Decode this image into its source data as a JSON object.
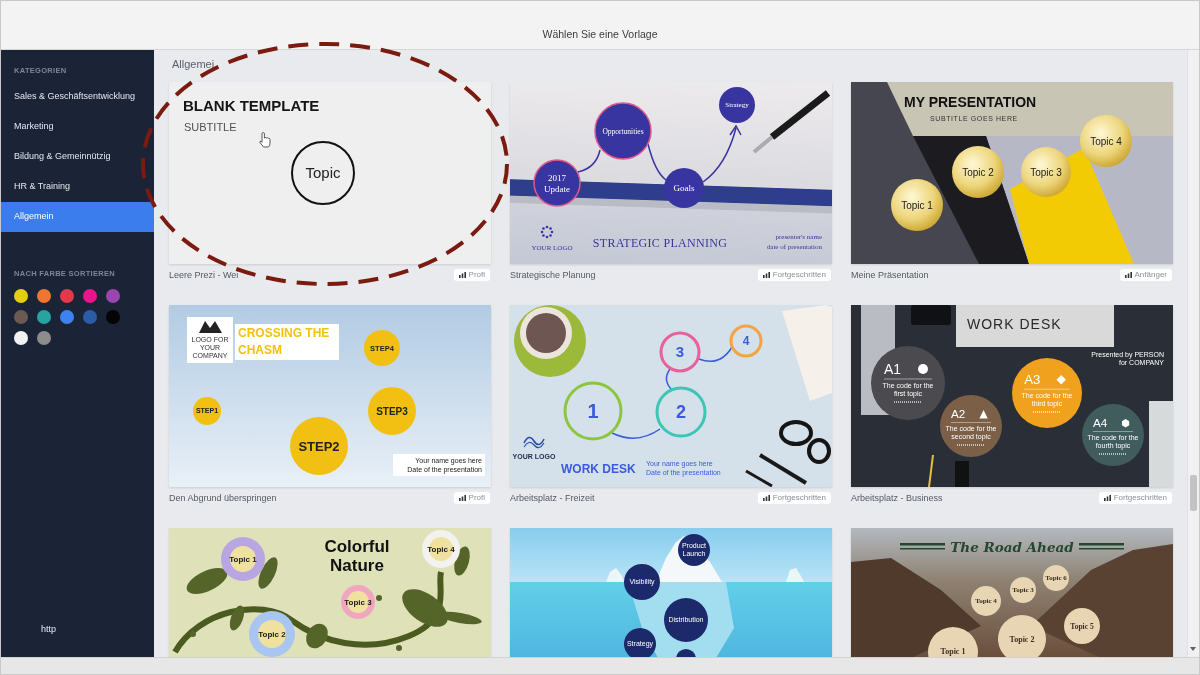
{
  "window": {
    "title": "Wählen Sie eine Vorlage"
  },
  "sidebar": {
    "categories_heading": "KATEGORIEN",
    "categories": [
      {
        "label": "Sales & Geschäftsentwicklung",
        "selected": false
      },
      {
        "label": "Marketing",
        "selected": false
      },
      {
        "label": "Bildung & Gemeinnützig",
        "selected": false
      },
      {
        "label": "HR & Training",
        "selected": false
      },
      {
        "label": "Allgemein",
        "selected": true
      }
    ],
    "color_heading": "NACH FARBE SORTIEREN",
    "colors": [
      {
        "color": "#e3cf10"
      },
      {
        "color": "#ee7432"
      },
      {
        "color": "#e23a4b"
      },
      {
        "color": "#e8168b"
      },
      {
        "color": "#9b45b0"
      },
      {
        "color": "#6c5a52"
      },
      {
        "color": "#28a3a0"
      },
      {
        "color": "#3c83ef"
      },
      {
        "color": "#2b5ca8"
      },
      {
        "color": "#040404"
      },
      {
        "color": "#f2f2f2"
      },
      {
        "color": "#8c8c8c"
      }
    ],
    "footer": "http"
  },
  "content": {
    "heading": "Allgemei",
    "templates": [
      {
        "name": "Leere Prezi - Wei",
        "difficulty": "Profi",
        "slide": {
          "kind": "blank",
          "title": "BLANK TEMPLATE",
          "subtitle": "SUBTITLE",
          "topic": "Topic"
        }
      },
      {
        "name": "Strategische Planung",
        "difficulty": "Fortgeschritten",
        "slide": {
          "kind": "strategy",
          "topics": [
            "Strategy",
            "Opportunities",
            "2017 Update",
            "Goals"
          ],
          "title": "STRATEGIC PLANNING",
          "logo": "YOUR LOGO",
          "presenter": "presenter's name",
          "date": "date of presentation"
        }
      },
      {
        "name": "Meine Präsentation",
        "difficulty": "Anfänger",
        "slide": {
          "kind": "geometric",
          "title": "MY PRESENTATION",
          "subtitle": "SUBTITLE GOES HERE",
          "topics": [
            "Topic 1",
            "Topic 2",
            "Topic 3",
            "Topic 4"
          ]
        }
      },
      {
        "name": "Den Abgrund überspringen",
        "difficulty": "Profi",
        "slide": {
          "kind": "chasm",
          "logo": "LOGO FOR YOUR COMPANY",
          "title": "CROSSING THE CHASM",
          "steps": [
            "STEP4",
            "STEP3",
            "STEP1",
            "STEP2"
          ],
          "name": "Your name goes here",
          "date": "Date of the presentation"
        }
      },
      {
        "name": "Arbeitsplatz - Freizeit",
        "difficulty": "Fortgeschritten",
        "slide": {
          "kind": "desk-leisure",
          "steps": [
            "1",
            "2",
            "3",
            "4"
          ],
          "logo": "YOUR LOGO",
          "title": "WORK DESK",
          "name": "Your name goes here",
          "date": "Date of the presentation"
        }
      },
      {
        "name": "Arbeitsplatz - Business",
        "difficulty": "Fortgeschritten",
        "slide": {
          "kind": "desk-business",
          "title": "WORK DESK",
          "presenter": "Presented by PERSON",
          "company": "for COMPANY",
          "topics": [
            {
              "label": "A1",
              "caption": "The code for the first topic"
            },
            {
              "label": "A2",
              "caption": "The code for the second topic"
            },
            {
              "label": "A3",
              "caption": "The code for the third topic"
            },
            {
              "label": "A4",
              "caption": "The code for the fourth topic"
            }
          ]
        }
      },
      {
        "slide": {
          "kind": "nature",
          "title": "Colorful Nature",
          "topics": [
            "Topic 1",
            "Topic 4",
            "Topic 3",
            "Topic 2"
          ]
        }
      },
      {
        "slide": {
          "kind": "iceberg",
          "topics": [
            "Product Launch",
            "Visibility",
            "Distribution",
            "Strategy"
          ]
        }
      },
      {
        "slide": {
          "kind": "road",
          "title": "The Road Ahead",
          "topics": [
            "Topic 4",
            "Topic 3",
            "Topic 6",
            "Topic 5",
            "Topic 2",
            "Topic 1"
          ]
        }
      }
    ]
  }
}
